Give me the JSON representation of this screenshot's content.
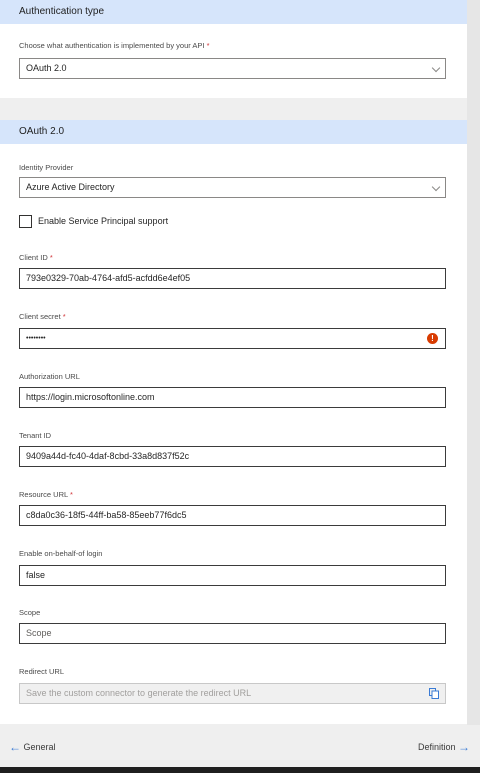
{
  "auth_type": {
    "header": "Authentication type",
    "label": "Choose what authentication is implemented by your API",
    "required_mark": "*",
    "selected": "OAuth 2.0"
  },
  "oauth": {
    "header": "OAuth 2.0",
    "identity_provider": {
      "label": "Identity Provider",
      "selected": "Azure Active Directory"
    },
    "service_principal": {
      "label": "Enable Service Principal support",
      "checked": false
    },
    "client_id": {
      "label": "Client ID",
      "required_mark": "*",
      "value": "793e0329-70ab-4764-afd5-acfdd6e4ef05"
    },
    "client_secret": {
      "label": "Client secret",
      "required_mark": "*",
      "value": "••••••••"
    },
    "authorization_url": {
      "label": "Authorization URL",
      "value": "https://login.microsoftonline.com"
    },
    "tenant_id": {
      "label": "Tenant ID",
      "value": "9409a44d-fc40-4daf-8cbd-33a8d837f52c"
    },
    "resource_url": {
      "label": "Resource URL",
      "required_mark": "*",
      "value": "c8da0c36-18f5-44ff-ba58-85eeb77f6dc5"
    },
    "on_behalf_of": {
      "label": "Enable on-behalf-of login",
      "value": "false"
    },
    "scope": {
      "label": "Scope",
      "placeholder": "Scope"
    },
    "redirect_url": {
      "label": "Redirect URL",
      "placeholder": "Save the custom connector to generate the redirect URL"
    }
  },
  "footer": {
    "back_label": "General",
    "next_label": "Definition",
    "back_arrow": "←",
    "next_arrow": "→"
  },
  "colors": {
    "header_bg": "#d6e5fb",
    "error": "#d83b01",
    "accent": "#3a7bd5"
  }
}
